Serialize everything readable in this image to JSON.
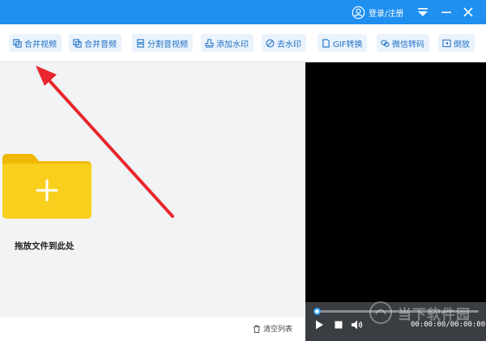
{
  "titlebar": {
    "login_label": "登录/注册",
    "icons": [
      "user-icon",
      "menu-icon",
      "minimize-icon",
      "close-icon"
    ],
    "background": "#1f8ff0"
  },
  "toolbar": {
    "tools": [
      {
        "label": "合并视频",
        "icon": "merge-video-icon"
      },
      {
        "label": "合并音频",
        "icon": "merge-audio-icon"
      },
      {
        "label": "分割音视频",
        "icon": "split-icon"
      },
      {
        "label": "添加水印",
        "icon": "add-watermark-icon"
      },
      {
        "label": "去水印",
        "icon": "remove-watermark-icon"
      },
      {
        "label": "GIF转换",
        "icon": "gif-icon"
      },
      {
        "label": "微信转码",
        "icon": "wechat-icon"
      },
      {
        "label": "倒放",
        "icon": "reverse-icon"
      }
    ]
  },
  "droparea": {
    "hint": "拖放文件到此处",
    "folder_color": "#f9cf1e",
    "arrow_color": "#e8262d"
  },
  "listbar": {
    "clear_label": "清空列表"
  },
  "player": {
    "timecode": "00:00:00/00:00:00",
    "progress": 0,
    "accent": "#2aa0ff"
  },
  "watermark": {
    "text": "当下软件园"
  }
}
